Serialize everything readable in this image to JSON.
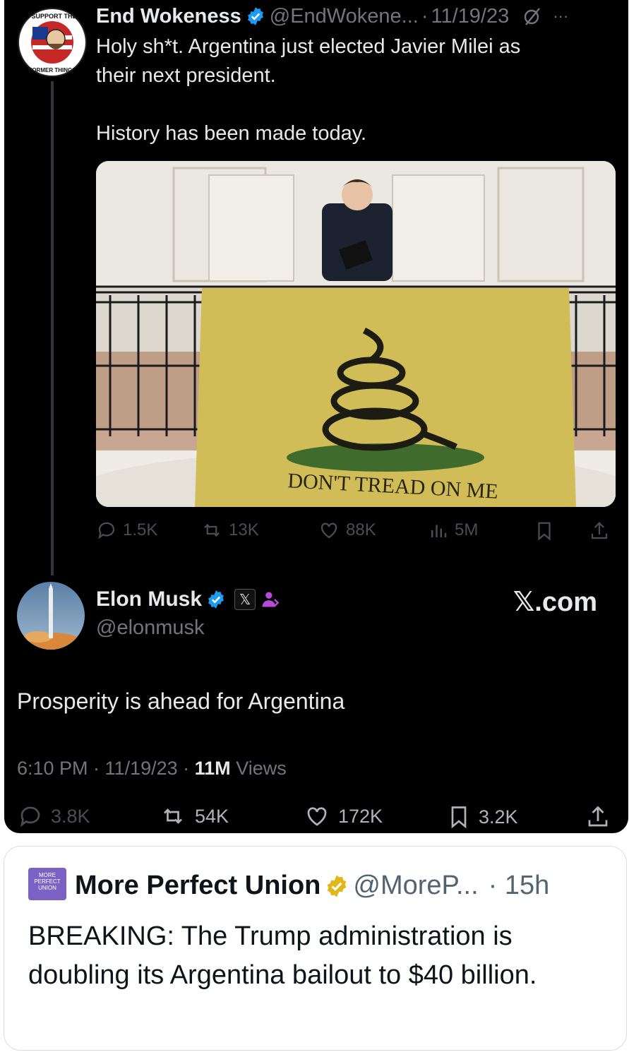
{
  "tweet1": {
    "name": "End Wokeness",
    "handle": "@EndWokene...",
    "sep": "·",
    "date": "11/19/23",
    "more": "···",
    "avatar_text_top": "I SUPPORT THE",
    "avatar_text_bottom": "FORMER THINGS",
    "text_line1": "Holy sh*t. Argentina just elected Javier Milei as",
    "text_line2": "their next president.",
    "text_line3": "History has been made today.",
    "photo_caption": "DON'T TREAD ON ME",
    "stats": {
      "replies": "1.5K",
      "reposts": "13K",
      "likes": "88K",
      "views": "5M"
    }
  },
  "tweet2": {
    "name": "Elon Musk",
    "x_badge": "𝕏",
    "handle": "@elonmusk",
    "brand": "𝕏.com",
    "text": "Prosperity is ahead for Argentina",
    "time": "6:10 PM · 11/19/23 · ",
    "views_count": "11M",
    "views_label": " Views",
    "stats": {
      "replies": "3.8K",
      "reposts": "54K",
      "likes": "172K",
      "bookmarks": "3.2K"
    }
  },
  "tweet3": {
    "logo_text": "MORE PERFECT UNION",
    "name": "More Perfect Union",
    "handle": "@MoreP...",
    "time": " · 15h",
    "text": "BREAKING: The Trump administration is doubling its Argentina bailout to $40 billion."
  },
  "colors": {
    "verified_blue": "#1d9bf0",
    "verified_gold": "#e2b719",
    "mpu_purple": "#7b61c4"
  }
}
